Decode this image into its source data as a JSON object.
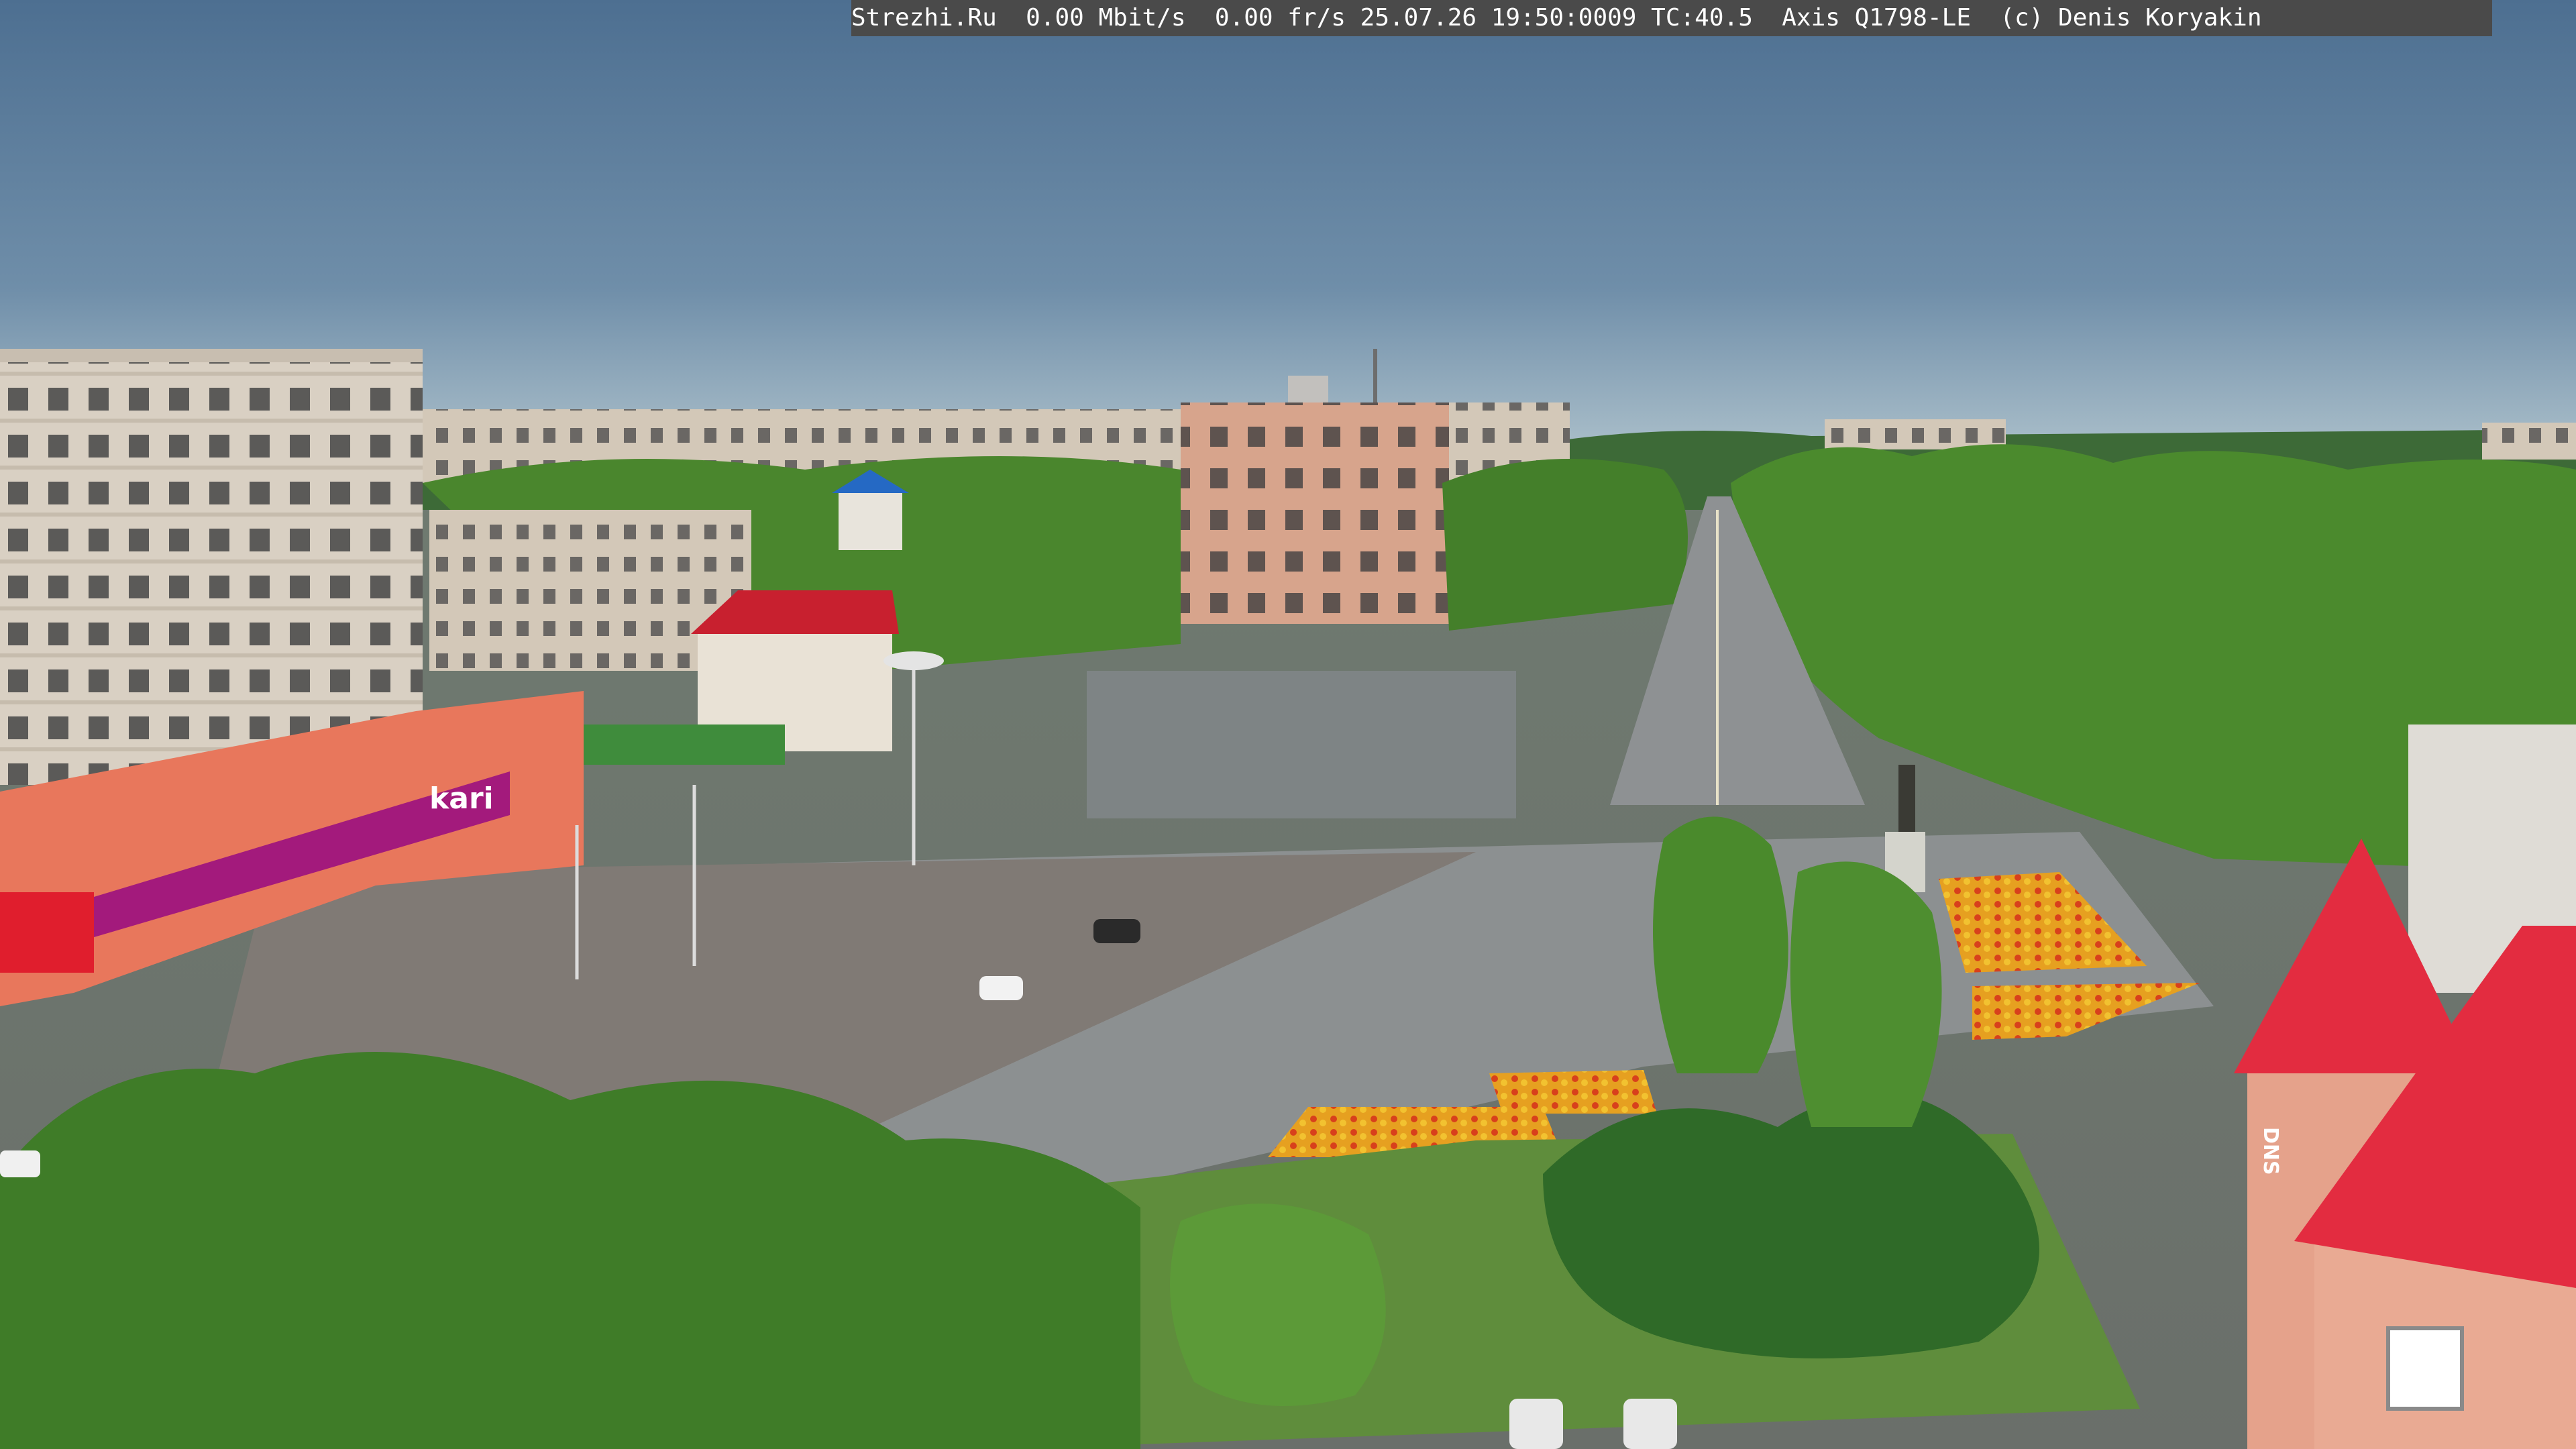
{
  "overlay": {
    "site": "Strezhi.Ru",
    "bitrate": "0.00 Mbit/s",
    "framerate": "0.00 fr/s",
    "datetime": "25.07.26 19:50:0009",
    "tc": "TC:40.5",
    "camera": "Axis Q1798-LE",
    "copyright": "(c) Denis Koryakin"
  },
  "signage": {
    "store_brand": "kari",
    "store_logo_text": "kari",
    "tower_sign": "DNS"
  },
  "colors": {
    "sky_top": "#4e7092",
    "sky_horizon": "#9fb5c2",
    "foliage": "#4d8a2e",
    "road": "#8a8d8f",
    "roof_red": "#e0203a",
    "kari_magenta": "#a31a7c",
    "building_panel": "#d8cfc1",
    "overlay_bg": "#4a4a4a"
  }
}
